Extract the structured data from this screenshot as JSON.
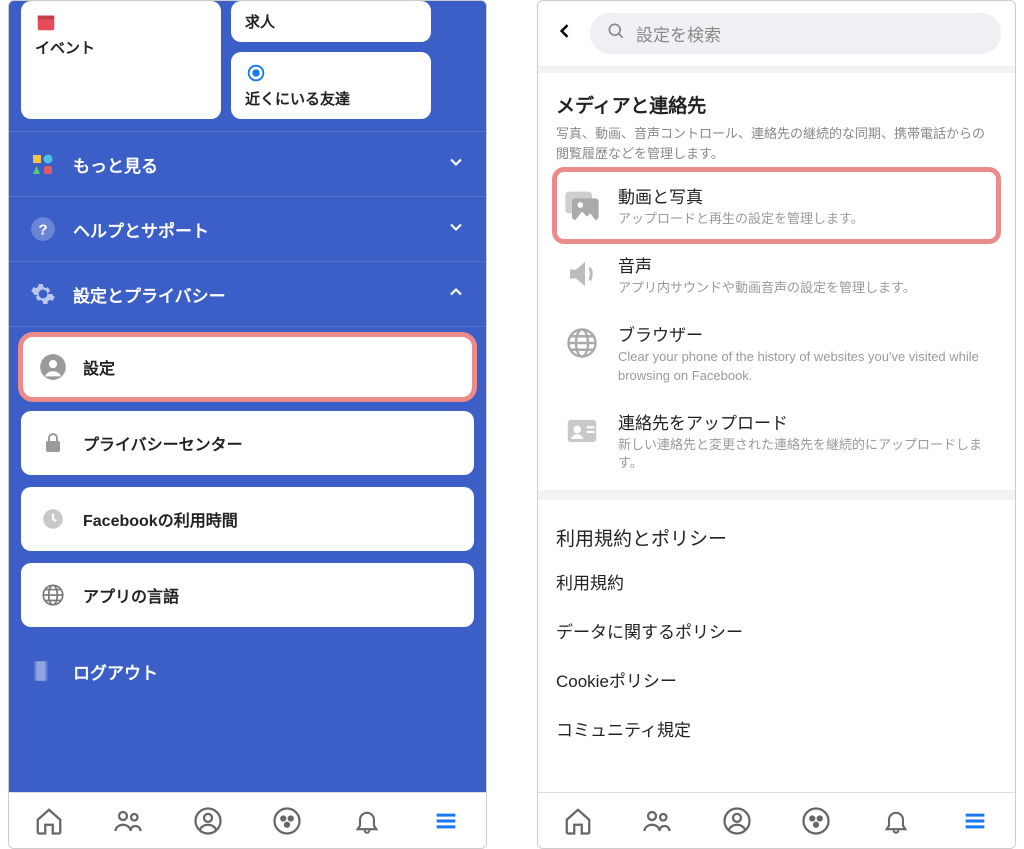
{
  "left": {
    "top_cards": {
      "event": "イベント",
      "jobs": "求人",
      "nearby": "近くにいる友達"
    },
    "acc": {
      "more": "もっと見る",
      "help": "ヘルプとサポート",
      "settings_privacy": "設定とプライバシー"
    },
    "cards": {
      "settings": "設定",
      "privacy_center": "プライバシーセンター",
      "time_on_fb": "Facebookの利用時間",
      "app_language": "アプリの言語"
    },
    "logout": "ログアウト"
  },
  "right": {
    "search_placeholder": "設定を検索",
    "media_section": {
      "title": "メディアと連絡先",
      "desc": "写真、動画、音声コントロール、連絡先の継続的な同期、携帯電話からの閲覧履歴などを管理します。",
      "rows": {
        "video_photo": {
          "title": "動画と写真",
          "sub": "アップロードと再生の設定を管理します。"
        },
        "audio": {
          "title": "音声",
          "sub": "アプリ内サウンドや動画音声の設定を管理します。"
        },
        "browser": {
          "title": "ブラウザー",
          "sub": "Clear your phone of the history of websites you've visited while browsing on Facebook."
        },
        "upload_contacts": {
          "title": "連絡先をアップロード",
          "sub": "新しい連絡先と変更された連絡先を継続的にアップロードします。"
        }
      }
    },
    "policy_section": {
      "title": "利用規約とポリシー",
      "links": {
        "terms": "利用規約",
        "data_policy": "データに関するポリシー",
        "cookie_policy": "Cookieポリシー",
        "community": "コミュニティ規定"
      }
    }
  }
}
